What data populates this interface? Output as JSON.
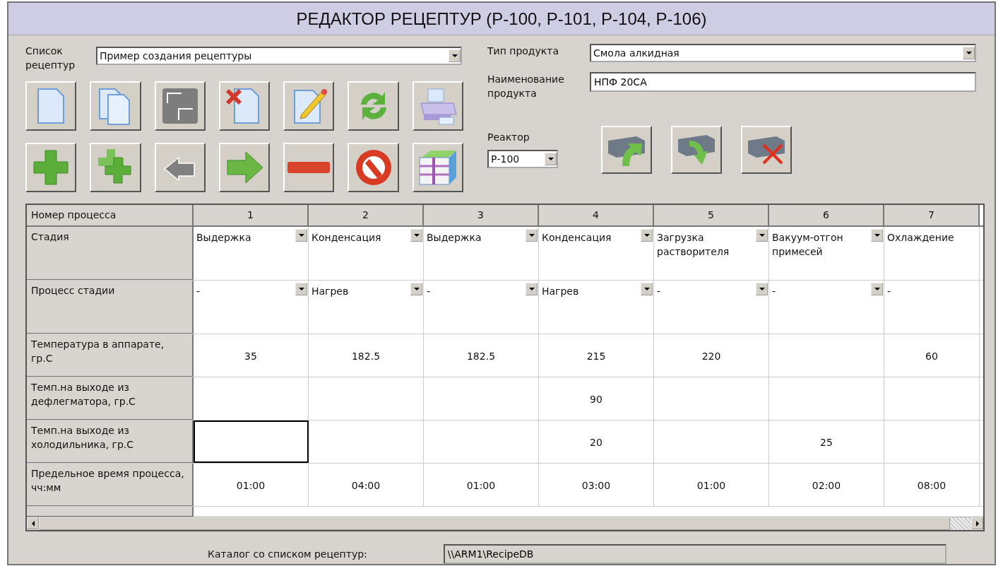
{
  "window": {
    "title": "РЕДАКТОР РЕЦЕПТУР (Р-100, Р-101, Р-104, Р-106)"
  },
  "recipe_list": {
    "label": "Список рецептур",
    "value": "Пример создания рецептуры"
  },
  "toolbar_top": [
    {
      "kind": "new",
      "disabled": false
    },
    {
      "kind": "copy",
      "disabled": false
    },
    {
      "kind": "save",
      "disabled": true
    },
    {
      "kind": "delete",
      "disabled": false
    },
    {
      "kind": "edit",
      "disabled": false
    },
    {
      "kind": "refresh",
      "disabled": false
    },
    {
      "kind": "print",
      "disabled": false
    }
  ],
  "toolbar_bottom": [
    {
      "kind": "add",
      "disabled": false
    },
    {
      "kind": "addmany",
      "disabled": false
    },
    {
      "kind": "back",
      "disabled": true
    },
    {
      "kind": "forward",
      "disabled": false
    },
    {
      "kind": "remove",
      "disabled": false
    },
    {
      "kind": "cancel",
      "disabled": false
    },
    {
      "kind": "archive",
      "disabled": false
    }
  ],
  "product_type": {
    "label": "Тип продукта",
    "value": "Смола алкидная"
  },
  "product_name": {
    "label": "Наименование продукта",
    "value": "НПФ 20СА"
  },
  "reactor": {
    "label": "Реактор",
    "value": "Р-100"
  },
  "reactor_buttons": [
    {
      "kind": "upload"
    },
    {
      "kind": "download"
    },
    {
      "kind": "unlink"
    }
  ],
  "table": {
    "corner": "Номер процесса",
    "columns": [
      "1",
      "2",
      "3",
      "4",
      "5",
      "6",
      "7"
    ],
    "rows": [
      {
        "label": "Стадия",
        "kind": "dropdown",
        "cells": [
          {
            "value": "Выдержка",
            "selected": false,
            "dropdown": true
          },
          {
            "value": "Конденсация",
            "selected": false,
            "dropdown": true
          },
          {
            "value": "Выдержка",
            "selected": false,
            "dropdown": true
          },
          {
            "value": "Конденсация",
            "selected": false,
            "dropdown": true
          },
          {
            "value": "Загрузка растворителя",
            "selected": false,
            "dropdown": true
          },
          {
            "value": "Вакуум-отгон примесей",
            "selected": false,
            "dropdown": true
          },
          {
            "value": "Охлаждение",
            "selected": false,
            "dropdown": false
          }
        ]
      },
      {
        "label": "Процесс стадии",
        "kind": "dropdown",
        "cells": [
          {
            "value": "-",
            "selected": false,
            "dropdown": true
          },
          {
            "value": "Нагрев",
            "selected": false,
            "dropdown": true
          },
          {
            "value": "-",
            "selected": false,
            "dropdown": true
          },
          {
            "value": "Нагрев",
            "selected": false,
            "dropdown": true
          },
          {
            "value": "-",
            "selected": false,
            "dropdown": true
          },
          {
            "value": "-",
            "selected": false,
            "dropdown": true
          },
          {
            "value": "-",
            "selected": false,
            "dropdown": false
          }
        ]
      },
      {
        "label": "Температура в аппарате, гр.С",
        "kind": "number",
        "cells": [
          {
            "value": "35",
            "selected": false
          },
          {
            "value": "182.5",
            "selected": false
          },
          {
            "value": "182.5",
            "selected": false
          },
          {
            "value": "215",
            "selected": false
          },
          {
            "value": "220",
            "selected": false
          },
          {
            "selected": false
          },
          {
            "value": "60",
            "selected": false
          }
        ]
      },
      {
        "label": "Темп.на выходе из дефлегматора, гр.С",
        "kind": "number",
        "cells": [
          {
            "selected": false
          },
          {
            "selected": false
          },
          {
            "selected": false
          },
          {
            "value": "90",
            "selected": false
          },
          {
            "selected": false
          },
          {
            "selected": false
          },
          {
            "selected": false
          }
        ]
      },
      {
        "label": "Темп.на выходе из холодильника, гр.С",
        "kind": "number",
        "cells": [
          {
            "selected": true
          },
          {
            "selected": false
          },
          {
            "selected": false
          },
          {
            "value": "20",
            "selected": false
          },
          {
            "selected": false
          },
          {
            "value": "25",
            "selected": false
          },
          {
            "selected": false
          }
        ]
      },
      {
        "label": "Предельное время процесса, чч:мм",
        "kind": "number",
        "cells": [
          {
            "value": "01:00",
            "selected": false
          },
          {
            "value": "04:00",
            "selected": false
          },
          {
            "value": "01:00",
            "selected": false
          },
          {
            "value": "03:00",
            "selected": false
          },
          {
            "value": "01:00",
            "selected": false
          },
          {
            "value": "02:00",
            "selected": false
          },
          {
            "value": "08:00",
            "selected": false
          }
        ]
      }
    ]
  },
  "catalog": {
    "label": "Каталог со списком рецептур:",
    "value": "\\\\ARM1\\RecipeDB"
  }
}
